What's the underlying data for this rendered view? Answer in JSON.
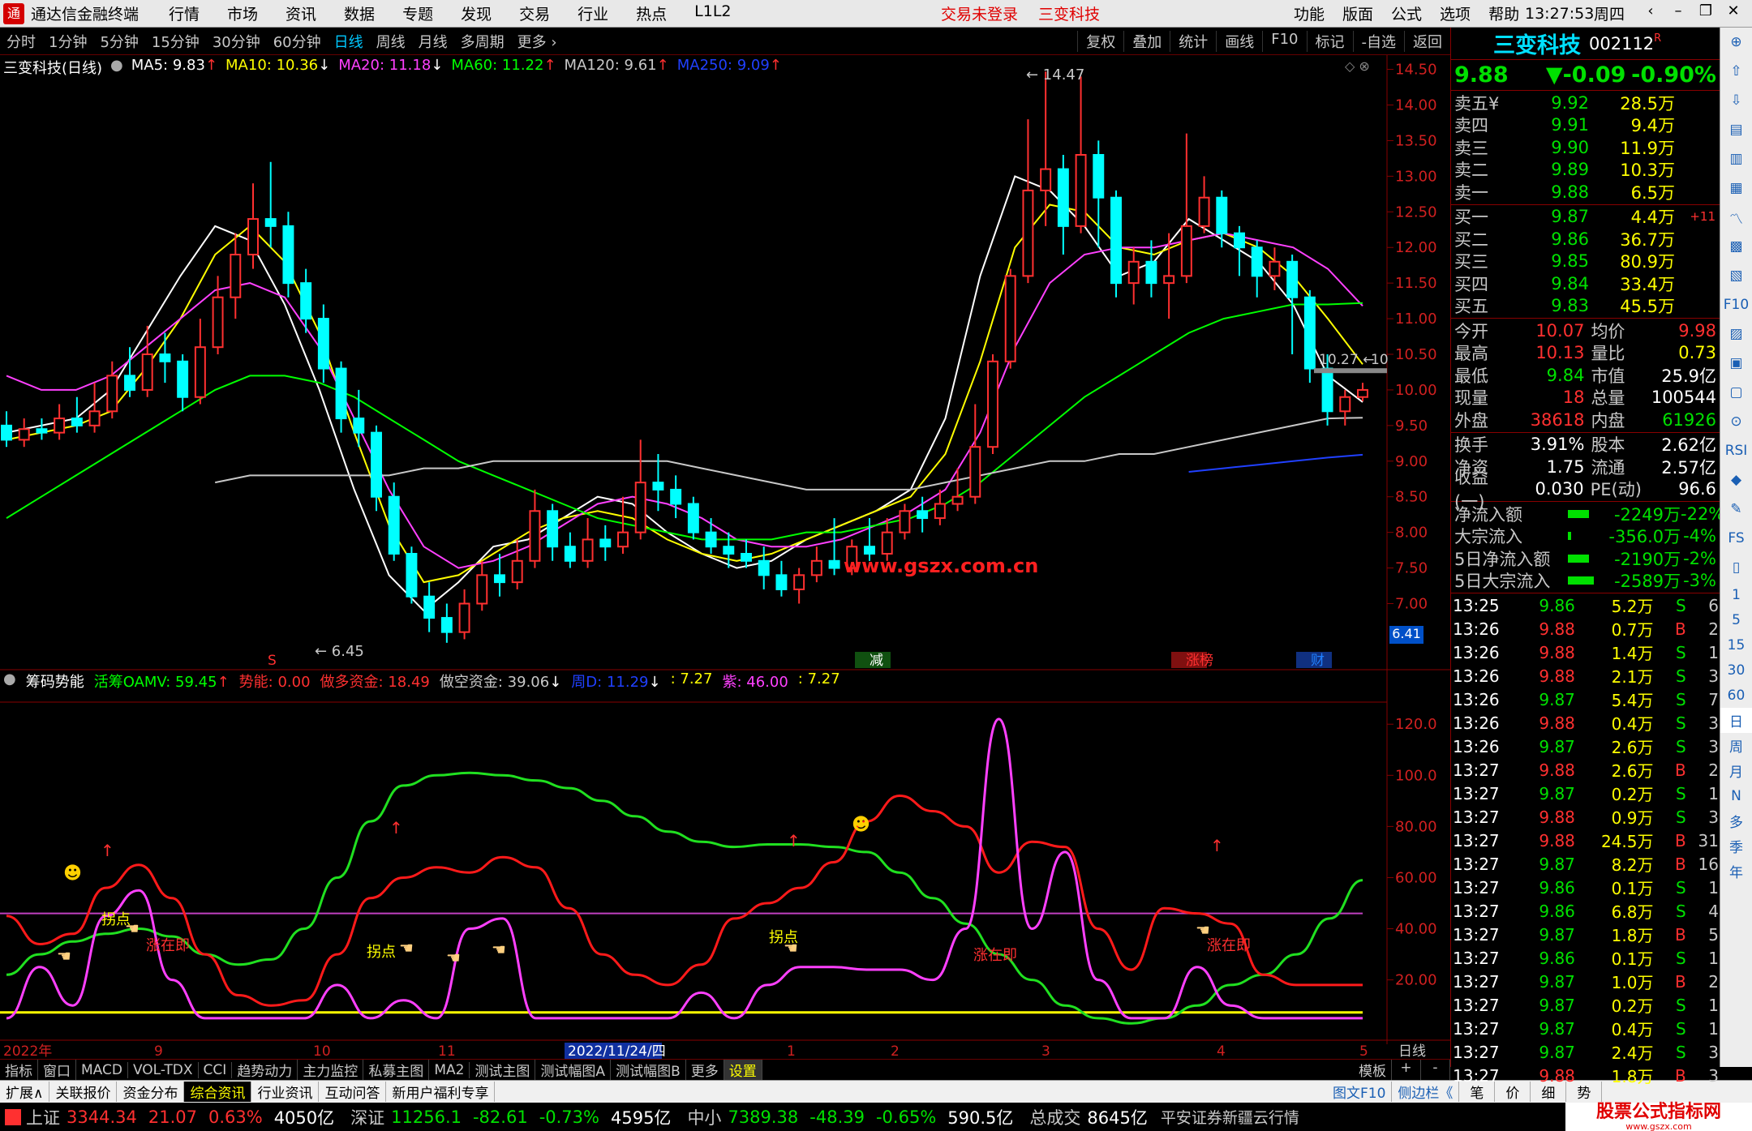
{
  "titlebar": {
    "app_name": "通达信金融终端",
    "menu": [
      "行情",
      "市场",
      "资讯",
      "数据",
      "专题",
      "发现",
      "交易",
      "行业",
      "热点",
      "L1L2"
    ],
    "trade_status": "交易未登录",
    "stock_name": "三变科技",
    "right_menu": [
      "功能",
      "版面",
      "公式",
      "选项",
      "帮助"
    ],
    "time": "13:27:53",
    "weekday": "周四"
  },
  "periodbar": {
    "tabs": [
      "分时",
      "1分钟",
      "5分钟",
      "15分钟",
      "30分钟",
      "60分钟",
      "日线",
      "周线",
      "月线",
      "多周期",
      "更多 ›"
    ],
    "active": "日线",
    "right_tabs": [
      "复权",
      "叠加",
      "统计",
      "画线",
      "F10",
      "标记",
      "-自选",
      "返回"
    ]
  },
  "main_chart": {
    "title": "三变科技(日线)",
    "ma": [
      {
        "label": "MA5: 9.83",
        "arrow": "↑",
        "color": "#ffffff"
      },
      {
        "label": "MA10: 10.36",
        "arrow": "↓",
        "color": "#ffff00"
      },
      {
        "label": "MA20: 11.18",
        "arrow": "↓",
        "color": "#ff40ff"
      },
      {
        "label": "MA60: 11.22",
        "arrow": "↑",
        "color": "#00ff00"
      },
      {
        "label": "MA120: 9.61",
        "arrow": "↑",
        "color": "#c8c8c8"
      },
      {
        "label": "MA250: 9.09",
        "arrow": "↑",
        "color": "#2040ff"
      }
    ],
    "y_ticks": [
      "14.50",
      "14.00",
      "13.50",
      "13.00",
      "12.50",
      "12.00",
      "11.50",
      "11.00",
      "10.50",
      "10.00",
      "9.50",
      "9.00",
      "8.50",
      "8.00",
      "7.50",
      "7.00"
    ],
    "y_values": [
      14.5,
      14,
      13.5,
      13,
      12.5,
      12,
      11.5,
      11,
      10.5,
      10,
      9.5,
      9,
      8.5,
      8,
      7.5,
      7
    ],
    "high_label": "14.47",
    "low_label": "6.45",
    "last_label": "10.27",
    "last_tag": "10",
    "bottom_tag": "6.41",
    "watermark": "www.gszx.com.cn",
    "markers": [
      "S",
      "减",
      "涨榜",
      "财"
    ],
    "candles": [
      [
        9.5,
        9.3,
        9.7,
        9.2
      ],
      [
        9.3,
        9.45,
        9.6,
        9.2
      ],
      [
        9.45,
        9.4,
        9.6,
        9.3
      ],
      [
        9.4,
        9.6,
        9.8,
        9.3
      ],
      [
        9.6,
        9.5,
        9.9,
        9.4
      ],
      [
        9.5,
        9.7,
        10.1,
        9.4
      ],
      [
        9.7,
        10.2,
        10.4,
        9.6
      ],
      [
        10.2,
        10.0,
        10.6,
        9.9
      ],
      [
        10.0,
        10.5,
        10.9,
        9.9
      ],
      [
        10.5,
        10.4,
        10.8,
        10.1
      ],
      [
        10.4,
        9.9,
        10.5,
        9.7
      ],
      [
        9.9,
        10.6,
        11.0,
        9.8
      ],
      [
        10.6,
        11.3,
        11.6,
        10.5
      ],
      [
        11.3,
        11.9,
        12.2,
        11.0
      ],
      [
        11.9,
        12.4,
        12.9,
        11.7
      ],
      [
        12.4,
        12.3,
        13.2,
        12.0
      ],
      [
        12.3,
        11.5,
        12.5,
        11.3
      ],
      [
        11.5,
        11.0,
        11.7,
        10.8
      ],
      [
        11.0,
        10.3,
        11.2,
        10.1
      ],
      [
        10.3,
        9.6,
        10.4,
        9.4
      ],
      [
        9.6,
        9.4,
        10.0,
        9.2
      ],
      [
        9.4,
        8.5,
        9.5,
        8.3
      ],
      [
        8.5,
        7.7,
        8.7,
        7.6
      ],
      [
        7.7,
        7.1,
        7.8,
        7.0
      ],
      [
        7.1,
        6.8,
        7.3,
        6.6
      ],
      [
        6.8,
        6.6,
        7.0,
        6.45
      ],
      [
        6.6,
        7.0,
        7.2,
        6.5
      ],
      [
        7.0,
        7.4,
        7.6,
        6.9
      ],
      [
        7.4,
        7.3,
        7.7,
        7.1
      ],
      [
        7.3,
        7.6,
        7.9,
        7.2
      ],
      [
        7.6,
        8.3,
        8.6,
        7.5
      ],
      [
        8.3,
        7.8,
        8.4,
        7.6
      ],
      [
        7.8,
        7.6,
        8.0,
        7.5
      ],
      [
        7.6,
        7.9,
        8.2,
        7.5
      ],
      [
        7.9,
        7.8,
        8.1,
        7.6
      ],
      [
        7.8,
        8.0,
        8.5,
        7.7
      ],
      [
        8.0,
        8.7,
        9.3,
        7.9
      ],
      [
        8.7,
        8.6,
        9.1,
        8.3
      ],
      [
        8.6,
        8.4,
        8.8,
        8.2
      ],
      [
        8.4,
        8.0,
        8.5,
        7.9
      ],
      [
        8.0,
        7.8,
        8.2,
        7.7
      ],
      [
        7.8,
        7.7,
        8.0,
        7.5
      ],
      [
        7.7,
        7.6,
        7.9,
        7.5
      ],
      [
        7.6,
        7.4,
        7.8,
        7.2
      ],
      [
        7.4,
        7.2,
        7.6,
        7.1
      ],
      [
        7.2,
        7.4,
        7.5,
        7.0
      ],
      [
        7.4,
        7.6,
        7.8,
        7.3
      ],
      [
        7.6,
        7.5,
        8.2,
        7.4
      ],
      [
        7.5,
        7.8,
        7.9,
        7.4
      ],
      [
        7.8,
        7.7,
        8.2,
        7.6
      ],
      [
        7.7,
        8.0,
        8.2,
        7.6
      ],
      [
        8.0,
        8.3,
        8.4,
        7.9
      ],
      [
        8.3,
        8.2,
        8.5,
        8.0
      ],
      [
        8.2,
        8.4,
        8.6,
        8.1
      ],
      [
        8.4,
        8.5,
        8.9,
        8.3
      ],
      [
        8.5,
        9.2,
        9.8,
        8.4
      ],
      [
        9.2,
        10.4,
        10.5,
        9.1
      ],
      [
        10.4,
        11.6,
        11.7,
        10.3
      ],
      [
        11.6,
        12.8,
        13.8,
        11.5
      ],
      [
        12.8,
        13.1,
        14.47,
        12.3
      ],
      [
        13.1,
        12.3,
        13.3,
        11.9
      ],
      [
        12.3,
        13.3,
        14.4,
        12.2
      ],
      [
        13.3,
        12.7,
        13.5,
        12.0
      ],
      [
        12.7,
        11.5,
        12.8,
        11.3
      ],
      [
        11.5,
        11.8,
        12.0,
        11.2
      ],
      [
        11.8,
        11.5,
        12.1,
        11.3
      ],
      [
        11.5,
        11.6,
        12.2,
        11.0
      ],
      [
        11.6,
        12.3,
        13.6,
        11.5
      ],
      [
        12.3,
        12.7,
        13.0,
        12.2
      ],
      [
        12.7,
        12.2,
        12.8,
        12.0
      ],
      [
        12.2,
        12.0,
        12.3,
        11.6
      ],
      [
        12.0,
        11.6,
        12.1,
        11.3
      ],
      [
        11.6,
        11.8,
        12.0,
        11.4
      ],
      [
        11.8,
        11.3,
        11.9,
        10.5
      ],
      [
        11.3,
        10.3,
        11.4,
        10.1
      ],
      [
        10.3,
        9.7,
        10.5,
        9.5
      ],
      [
        9.7,
        9.9,
        10.0,
        9.5
      ],
      [
        9.9,
        10.0,
        10.1,
        9.84
      ]
    ],
    "ma_lines": {
      "ma5": [
        9.4,
        9.5,
        9.6,
        10.0,
        10.8,
        11.6,
        12.3,
        12.1,
        11.2,
        10.0,
        8.6,
        7.4,
        6.9,
        7.3,
        7.8,
        7.9,
        8.2,
        8.5,
        8.4,
        8.0,
        7.7,
        7.5,
        7.6,
        7.9,
        8.1,
        8.3,
        8.6,
        9.6,
        11.6,
        13.0,
        12.8,
        12.3,
        11.6,
        11.8,
        12.4,
        12.1,
        11.8,
        11.2,
        10.2,
        9.83
      ],
      "ma10": [
        9.3,
        9.4,
        9.5,
        9.7,
        10.3,
        11.0,
        11.9,
        12.3,
        11.8,
        10.8,
        9.4,
        8.1,
        7.3,
        7.4,
        7.7,
        8.0,
        8.2,
        8.3,
        8.2,
        7.9,
        7.7,
        7.6,
        7.7,
        7.9,
        8.1,
        8.3,
        8.5,
        9.1,
        10.4,
        12.0,
        12.6,
        12.5,
        12.0,
        11.9,
        12.1,
        12.2,
        12.0,
        11.6,
        11.0,
        10.36
      ],
      "ma20": [
        10.2,
        10.0,
        10.0,
        10.2,
        10.6,
        11.0,
        11.4,
        11.5,
        11.3,
        10.6,
        9.6,
        8.6,
        7.8,
        7.5,
        7.6,
        7.8,
        8.1,
        8.4,
        8.5,
        8.4,
        8.2,
        7.9,
        7.8,
        7.8,
        7.9,
        8.1,
        8.3,
        8.6,
        9.4,
        10.6,
        11.5,
        11.9,
        12.0,
        12.0,
        12.1,
        12.2,
        12.1,
        12.0,
        11.7,
        11.18
      ],
      "ma60": [
        8.2,
        8.5,
        8.8,
        9.1,
        9.4,
        9.7,
        10.0,
        10.2,
        10.2,
        10.1,
        9.9,
        9.6,
        9.3,
        9.0,
        8.8,
        8.6,
        8.4,
        8.2,
        8.1,
        8.0,
        7.9,
        7.9,
        7.9,
        8.0,
        8.0,
        8.1,
        8.2,
        8.4,
        8.7,
        9.1,
        9.5,
        9.9,
        10.2,
        10.5,
        10.8,
        11.0,
        11.1,
        11.2,
        11.2,
        11.22
      ],
      "ma120": [
        null,
        null,
        null,
        null,
        null,
        null,
        8.7,
        8.8,
        8.8,
        8.8,
        8.8,
        8.8,
        8.9,
        8.9,
        9.0,
        9.0,
        9.0,
        9.0,
        9.0,
        9.0,
        8.9,
        8.8,
        8.7,
        8.6,
        8.6,
        8.6,
        8.6,
        8.7,
        8.8,
        8.9,
        9.0,
        9.0,
        9.1,
        9.1,
        9.2,
        9.3,
        9.4,
        9.5,
        9.6,
        9.61
      ],
      "ma250": [
        null,
        null,
        null,
        null,
        null,
        null,
        null,
        null,
        null,
        null,
        null,
        null,
        null,
        null,
        null,
        null,
        null,
        null,
        null,
        null,
        null,
        null,
        null,
        null,
        null,
        null,
        null,
        null,
        null,
        null,
        null,
        null,
        null,
        null,
        8.85,
        8.9,
        8.95,
        9.0,
        9.05,
        9.09
      ]
    }
  },
  "indicator": {
    "title": "筹码势能",
    "values": [
      {
        "label": "活筹OAMV: 59.45",
        "arrow": "↑",
        "color": "#00ff00"
      },
      {
        "label": "势能: 0.00",
        "arrow": "",
        "color": "#ff3030"
      },
      {
        "label": "做多资金: 18.49",
        "arrow": "",
        "color": "#ff3030"
      },
      {
        "label": "做空资金: 39.06",
        "arrow": "↓",
        "color": "#c8c8c8"
      },
      {
        "label": "周D: 11.29",
        "arrow": "↓",
        "color": "#2040ff"
      },
      {
        "label": ": 7.27",
        "arrow": "",
        "color": "#ffff00"
      },
      {
        "label": "紫: 46.00",
        "arrow": "",
        "color": "#ff40ff"
      },
      {
        "label": ": 7.27",
        "arrow": "",
        "color": "#ffff00"
      }
    ],
    "y_ticks": [
      "120.0",
      "100.0",
      "80.00",
      "60.00",
      "40.00",
      "20.00"
    ],
    "y_values": [
      120,
      100,
      80,
      60,
      40,
      20
    ],
    "labels": [
      "拐点",
      "涨在即",
      "拐点",
      "拐点",
      "涨在即",
      "涨在即"
    ],
    "green": [
      22,
      30,
      35,
      38,
      40,
      37,
      30,
      26,
      28,
      40,
      60,
      82,
      96,
      100,
      101,
      100,
      98,
      95,
      90,
      84,
      78,
      74,
      72,
      73,
      73,
      72,
      70,
      62,
      52,
      42,
      30,
      20,
      10,
      5,
      3,
      5,
      10,
      18,
      22,
      30,
      44,
      59
    ],
    "red": [
      45,
      34,
      38,
      56,
      65,
      52,
      30,
      14,
      10,
      12,
      30,
      52,
      60,
      64,
      62,
      68,
      64,
      48,
      30,
      22,
      18,
      26,
      44,
      50,
      56,
      66,
      82,
      92,
      86,
      80,
      62,
      74,
      72,
      40,
      24,
      48,
      46,
      42,
      22,
      18,
      18,
      18
    ],
    "pink": [
      5,
      25,
      10,
      45,
      55,
      20,
      5,
      5,
      5,
      5,
      18,
      5,
      12,
      5,
      40,
      44,
      5,
      5,
      5,
      5,
      5,
      15,
      5,
      18,
      25,
      25,
      24,
      24,
      20,
      40,
      122,
      40,
      70,
      20,
      5,
      5,
      25,
      10,
      5,
      5,
      5,
      5
    ]
  },
  "x_axis": {
    "labels": [
      "2022年",
      "9",
      "10",
      "11",
      "2022/11/24/四",
      "1",
      "2",
      "3",
      "4",
      "5"
    ],
    "period": "日线"
  },
  "indicator_tabs": {
    "items": [
      "指标",
      "窗口",
      "MACD",
      "VOL-TDX",
      "CCI",
      "趋势动力",
      "主力监控",
      "私募主图",
      "MA2",
      "测试主图",
      "测试幅图A",
      "测试幅图B",
      "更多",
      "设置"
    ],
    "active": "设置",
    "right": [
      "模板",
      "+",
      "-"
    ]
  },
  "function_bar": {
    "items": [
      "扩展∧",
      "关联报价",
      "资金分布",
      "综合资讯",
      "行业资讯",
      "互动问答",
      "新用户福利专享"
    ],
    "right": [
      "图文F10",
      "侧边栏《",
      "笔",
      "价",
      "细",
      "势"
    ]
  },
  "status_bar": {
    "items": [
      {
        "name": "上证",
        "value": "3344.34",
        "chg": "21.07",
        "pct": "0.63%",
        "amt": "4050亿",
        "color": "#ff3030"
      },
      {
        "name": "深证",
        "value": "11256.1",
        "chg": "-82.61",
        "pct": "-0.73%",
        "amt": "4595亿",
        "color": "#00e000"
      },
      {
        "name": "中小",
        "value": "7389.38",
        "chg": "-48.39",
        "pct": "-0.65%",
        "amt": "590.5亿",
        "color": "#00e000"
      }
    ],
    "total_label": "总成交",
    "total": "8645亿",
    "broker": "平安证券新疆云行情",
    "logo": "股票公式指标网",
    "logo_url": "www.gszx.com"
  },
  "quote": {
    "name": "三变科技",
    "code": "002112",
    "r_mark": "R",
    "price": "9.88",
    "change": "▼-0.09",
    "pct": "-0.90%",
    "asks": [
      {
        "l": "卖五",
        "p": "9.92",
        "v": "28.5万"
      },
      {
        "l": "卖四",
        "p": "9.91",
        "v": "9.4万"
      },
      {
        "l": "卖三",
        "p": "9.90",
        "v": "11.9万"
      },
      {
        "l": "卖二",
        "p": "9.89",
        "v": "10.3万"
      },
      {
        "l": "卖一",
        "p": "9.88",
        "v": "6.5万"
      }
    ],
    "ask5_suffix": "¥",
    "bids": [
      {
        "l": "买一",
        "p": "9.87",
        "v": "4.4万",
        "x": "+11"
      },
      {
        "l": "买二",
        "p": "9.86",
        "v": "36.7万",
        "x": ""
      },
      {
        "l": "买三",
        "p": "9.85",
        "v": "80.9万",
        "x": ""
      },
      {
        "l": "买四",
        "p": "9.84",
        "v": "33.4万",
        "x": ""
      },
      {
        "l": "买五",
        "p": "9.83",
        "v": "45.5万",
        "x": ""
      }
    ],
    "stats1": [
      [
        "今开",
        "10.07",
        "均价",
        "9.98"
      ],
      [
        "最高",
        "10.13",
        "量比",
        "0.73"
      ],
      [
        "最低",
        "9.84",
        "市值",
        "25.9亿"
      ],
      [
        "现量",
        "18",
        "总量",
        "100544"
      ],
      [
        "外盘",
        "38618",
        "内盘",
        "61926"
      ]
    ],
    "stats2": [
      [
        "换手",
        "3.91%",
        "股本",
        "2.62亿"
      ],
      [
        "净资",
        "1.75",
        "流通",
        "2.57亿"
      ],
      [
        "收益(一)",
        "0.030",
        "PE(动)",
        "96.6"
      ]
    ],
    "flows": [
      {
        "l": "净流入额",
        "v": "-2249万",
        "p": "-22%",
        "w": 0.6
      },
      {
        "l": "大宗流入",
        "v": "-356.0万",
        "p": "-4%",
        "w": 0.1
      },
      {
        "l": "5日净流入额",
        "v": "-2190万",
        "p": "-2%",
        "w": 0.6
      },
      {
        "l": "5日大宗流入",
        "v": "-2589万",
        "p": "-3%",
        "w": 0.75
      }
    ],
    "ticks": [
      [
        "13:25",
        "9.86",
        "5.2万",
        "S",
        "6"
      ],
      [
        "13:26",
        "9.88",
        "0.7万",
        "B",
        "2"
      ],
      [
        "13:26",
        "9.88",
        "1.4万",
        "S",
        "1"
      ],
      [
        "13:26",
        "9.88",
        "2.1万",
        "S",
        "3"
      ],
      [
        "13:26",
        "9.87",
        "5.4万",
        "S",
        "7"
      ],
      [
        "13:26",
        "9.88",
        "0.4万",
        "S",
        "3"
      ],
      [
        "13:26",
        "9.87",
        "2.6万",
        "S",
        "3"
      ],
      [
        "13:27",
        "9.88",
        "2.6万",
        "B",
        "2"
      ],
      [
        "13:27",
        "9.87",
        "0.2万",
        "S",
        "1"
      ],
      [
        "13:27",
        "9.88",
        "0.9万",
        "S",
        "3"
      ],
      [
        "13:27",
        "9.88",
        "24.5万",
        "B",
        "31"
      ],
      [
        "13:27",
        "9.87",
        "8.2万",
        "B",
        "16"
      ],
      [
        "13:27",
        "9.86",
        "0.1万",
        "S",
        "1"
      ],
      [
        "13:27",
        "9.86",
        "6.8万",
        "S",
        "4"
      ],
      [
        "13:27",
        "9.87",
        "1.8万",
        "B",
        "5"
      ],
      [
        "13:27",
        "9.86",
        "0.1万",
        "S",
        "1"
      ],
      [
        "13:27",
        "9.87",
        "1.0万",
        "B",
        "2"
      ],
      [
        "13:27",
        "9.87",
        "0.2万",
        "S",
        "1"
      ],
      [
        "13:27",
        "9.87",
        "0.4万",
        "S",
        "1"
      ],
      [
        "13:27",
        "9.87",
        "2.4万",
        "S",
        "3"
      ],
      [
        "13:27",
        "9.88",
        "1.8万",
        "B",
        "3"
      ]
    ]
  },
  "vtoolbar": {
    "items": [
      "⊕",
      "⇧",
      "⇩",
      "▤",
      "▥",
      "▦",
      "〽",
      "▩",
      "▧",
      "F10",
      "▨",
      "▣",
      "▢",
      "⊙",
      "RSI",
      "◆",
      "✎",
      "FS",
      "▯",
      "1",
      "5",
      "15",
      "30",
      "60",
      "日",
      "周",
      "月",
      "N",
      "多",
      "季",
      "年"
    ]
  }
}
